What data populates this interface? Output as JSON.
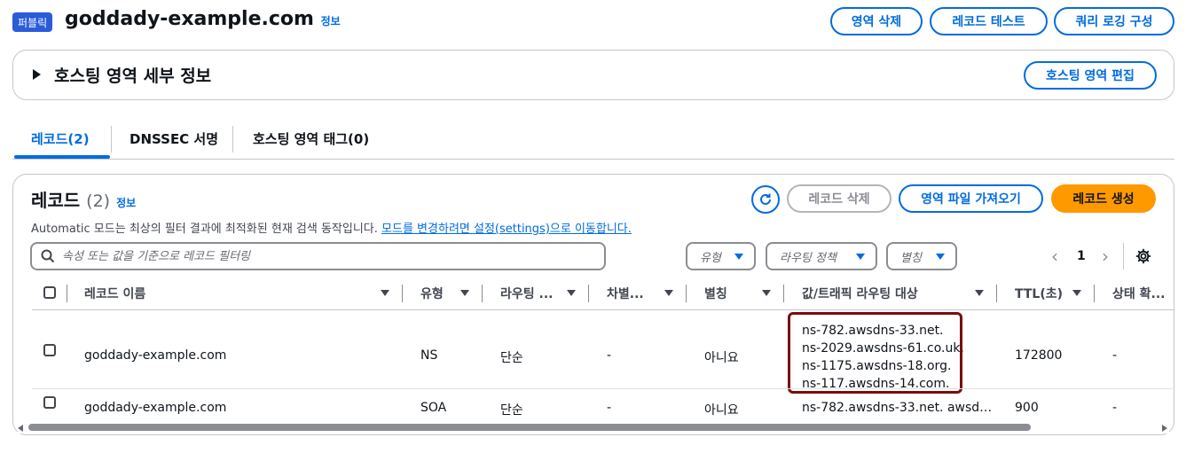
{
  "header": {
    "badge": "퍼블릭",
    "title": "goddady-example.com",
    "info": "정보",
    "buttons": {
      "delete_zone": "영역 삭제",
      "test_record": "레코드 테스트",
      "query_logging": "쿼리 로깅 구성"
    }
  },
  "details_panel": {
    "title": "호스팅 영역 세부 정보",
    "edit_button": "호스팅 영역 편집"
  },
  "tabs": [
    {
      "label": "레코드(2)",
      "active": true
    },
    {
      "label": "DNSSEC 서명",
      "active": false
    },
    {
      "label": "호스팅 영역 태그(0)",
      "active": false
    }
  ],
  "records": {
    "title": "레코드",
    "count": "(2)",
    "info": "정보",
    "description": "Automatic 모드는 최상의 필터 결과에 최적화된 현재 검색 동작입니다.",
    "settings_link": "모드를 변경하려면 설정(settings)으로 이동합니다.",
    "buttons": {
      "delete": "레코드 삭제",
      "import": "영역 파일 가져오기",
      "create": "레코드 생성"
    },
    "search_placeholder": "속성 또는 값을 기준으로 레코드 필터링",
    "filters": {
      "type": "유형",
      "routing": "라우팅 정책",
      "alias": "별칭"
    },
    "pagination": {
      "page": "1",
      "prev": "‹",
      "next": "›"
    },
    "columns": [
      "레코드 이름",
      "유형",
      "라우팅 ...",
      "차별...",
      "별칭",
      "값/트래픽 라우팅 대상",
      "TTL(초)",
      "상태 확..."
    ],
    "rows": [
      {
        "name": "goddady-example.com",
        "type": "NS",
        "routing": "단순",
        "diff": "-",
        "alias": "아니요",
        "values": [
          "ns-782.awsdns-33.net.",
          "ns-2029.awsdns-61.co.uk.",
          "ns-1175.awsdns-18.org.",
          "ns-117.awsdns-14.com."
        ],
        "ttl": "172800",
        "health": "-"
      },
      {
        "name": "goddady-example.com",
        "type": "SOA",
        "routing": "단순",
        "diff": "-",
        "alias": "아니요",
        "values": [
          "ns-782.awsdns-33.net. awsd…"
        ],
        "ttl": "900",
        "health": "-"
      }
    ]
  },
  "colors": {
    "accent": "#006ce0",
    "primary": "#ff9900",
    "highlight": "#7b0c0c"
  },
  "icons": {
    "refresh": "refresh-icon",
    "search": "search-icon",
    "settings": "gear-icon"
  }
}
